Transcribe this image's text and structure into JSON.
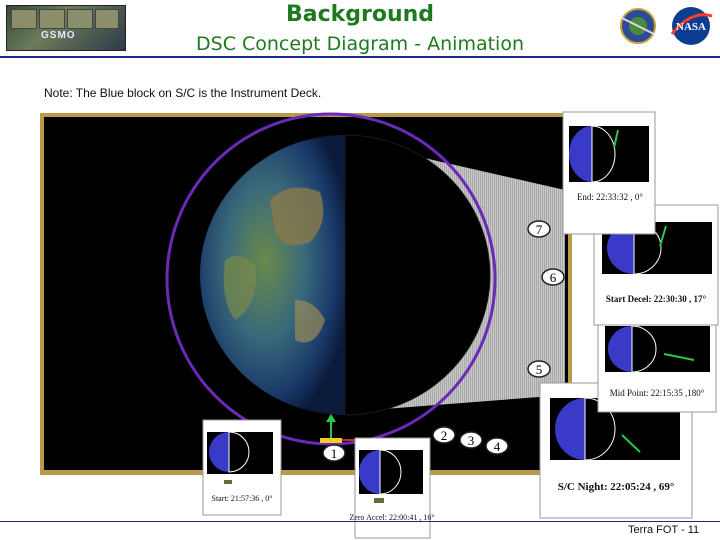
{
  "header": {
    "title": "Background",
    "subtitle": "DSC Concept Diagram - Animation",
    "logo_left_text": "GSMO",
    "logo_right_text": "NASA"
  },
  "note": "Note: The Blue block on S/C is the Instrument Deck.",
  "markers": [
    "1",
    "2",
    "3",
    "4",
    "5",
    "6",
    "7"
  ],
  "insets": {
    "start": "Start: 21:57:36 , 0°",
    "zero_accel": "Zero Accel: 22:00:41 , 16°",
    "sc_night": "S/C Night: 22:05:24 , 69°",
    "mid_point": "Mid Point: 22:15:35 ,180°",
    "start_decel": "Start Decel: 22:30:30 , 17°",
    "end": "End: 22:33:32 , 0°"
  },
  "footer": "Terra FOT - 11",
  "colors": {
    "title_green": "#1f7a1f",
    "orbit_purple": "#6a2ab8",
    "deck_blue": "#3a3ac8",
    "frame_olive": "#b99a4a",
    "rule_navy": "#1a2a8a"
  }
}
